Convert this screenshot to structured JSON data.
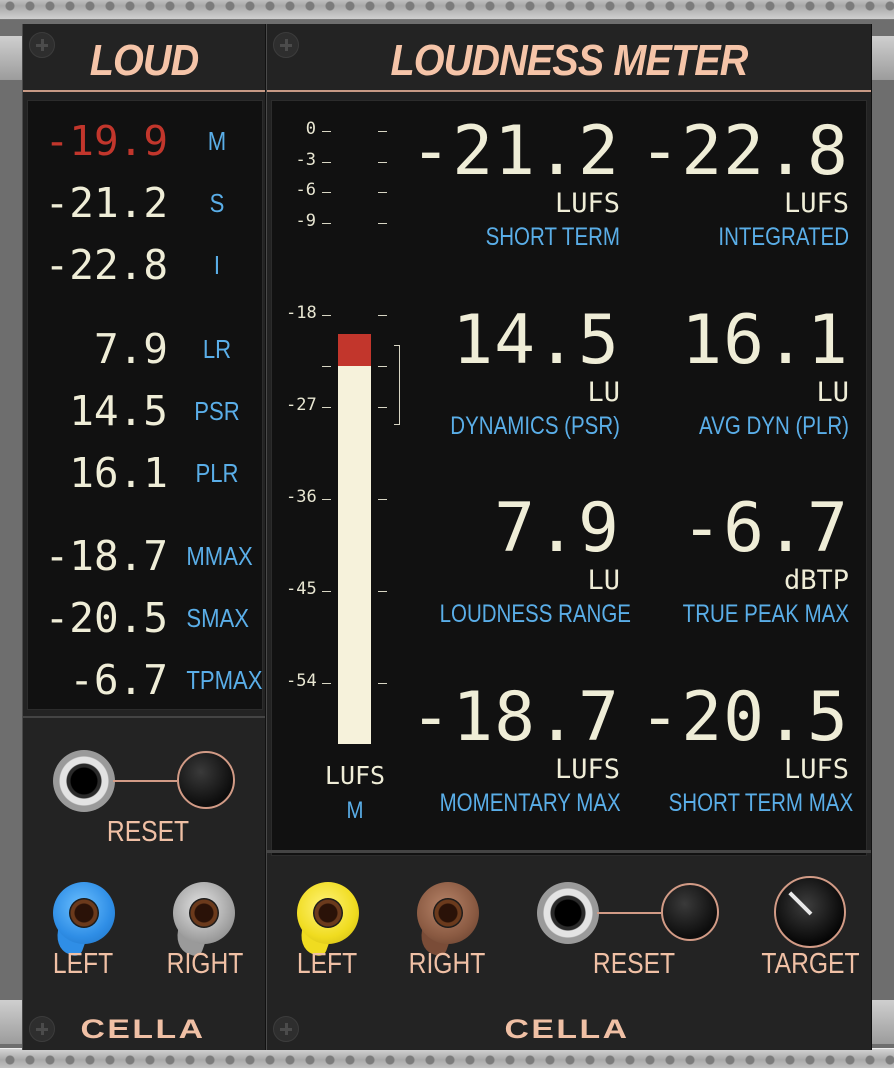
{
  "colors": {
    "panel": "#232323",
    "display": "#111111",
    "value_text": "#efedd7",
    "label_blue": "#5aaee8",
    "title_peach": "#f5c4a8",
    "warning_red": "#c2362c",
    "jack_blue": "#2f8ee6",
    "jack_gray": "#a5a5a5",
    "jack_yellow": "#f0dc20",
    "jack_brown": "#8a5a42"
  },
  "left_module": {
    "title": "LOUD",
    "readings": [
      {
        "value": "-19.9",
        "label": "M"
      },
      {
        "value": "-21.2",
        "label": "S"
      },
      {
        "value": "-22.8",
        "label": "I"
      },
      {
        "value": "7.9",
        "label": "LR"
      },
      {
        "value": "14.5",
        "label": "PSR"
      },
      {
        "value": "16.1",
        "label": "PLR"
      },
      {
        "value": "-18.7",
        "label": "MMAX"
      },
      {
        "value": "-20.5",
        "label": "SMAX"
      },
      {
        "value": "-6.7",
        "label": "TPMAX"
      }
    ],
    "reset_label": "RESET",
    "left_label": "LEFT",
    "right_label": "RIGHT",
    "brand": "CELLA"
  },
  "right_module": {
    "title": "LOUDNESS METER",
    "meter": {
      "ticks": [
        "0",
        "-3",
        "-6",
        "-9",
        "-18",
        "-27",
        "-36",
        "-45",
        "-54"
      ],
      "unit": "LUFS",
      "mode": "M",
      "level_lufs": -19.9,
      "red_zone_start_lufs": -23.0
    },
    "cells": [
      {
        "value": "-21.2",
        "unit": "LUFS",
        "caption": "SHORT TERM"
      },
      {
        "value": "-22.8",
        "unit": "LUFS",
        "caption": "INTEGRATED"
      },
      {
        "value": "14.5",
        "unit": "LU",
        "caption": "DYNAMICS (PSR)"
      },
      {
        "value": "16.1",
        "unit": "LU",
        "caption": "AVG DYN (PLR)"
      },
      {
        "value": "7.9",
        "unit": "LU",
        "caption": "LOUDNESS RANGE"
      },
      {
        "value": "-6.7",
        "unit": "dBTP",
        "caption": "TRUE PEAK MAX"
      },
      {
        "value": "-18.7",
        "unit": "LUFS",
        "caption": "MOMENTARY MAX"
      },
      {
        "value": "-20.5",
        "unit": "LUFS",
        "caption": "SHORT TERM MAX"
      }
    ],
    "left_label": "LEFT",
    "right_label": "RIGHT",
    "reset_label": "RESET",
    "target_label": "TARGET",
    "brand": "CELLA"
  }
}
